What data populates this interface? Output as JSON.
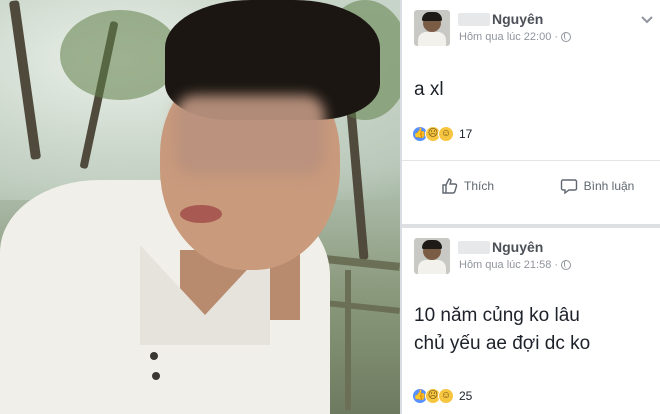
{
  "posts": [
    {
      "author": "Nguyên",
      "time": "Hôm qua lúc 22:00",
      "separator": "·",
      "text": "a xl",
      "reactions": [
        "like",
        "sad",
        "haha"
      ],
      "reaction_count": "17",
      "actions": {
        "like": "Thích",
        "comment": "Bình luận"
      }
    },
    {
      "author": "Nguyên",
      "time": "Hôm qua lúc 21:58",
      "separator": "·",
      "text_line1": "10 năm củng ko lâu",
      "text_line2": "chủ yếu ae đợi dc ko",
      "reactions": [
        "like",
        "sad",
        "haha"
      ],
      "reaction_count": "25"
    }
  ],
  "colors": {
    "accent": "#5890ff",
    "reaction_yellow": "#f7c640",
    "text": "#1d2129",
    "muted": "#90949c"
  }
}
